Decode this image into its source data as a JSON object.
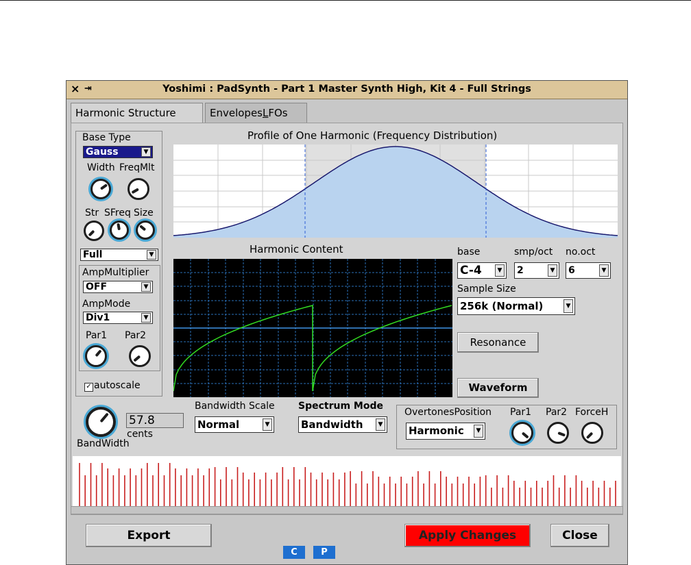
{
  "window": {
    "title": "Yoshimi : PadSynth - Part 1 Master Synth High, Kit 4 - Full Strings",
    "close_glyph": "×",
    "pin_glyph": "⇥"
  },
  "tabs": [
    {
      "label": "Harmonic Structure"
    },
    {
      "label": "EnvelopesLFOs"
    }
  ],
  "left": {
    "base_type_label": "Base Type",
    "base_type_value": "Gauss",
    "width_label": "Width",
    "freqmlt_label": "FreqMlt",
    "str_label": "Str",
    "sfreq_label": "SFreq",
    "size_label": "Size",
    "full_value": "Full",
    "ampmultiplier_label": "AmpMultiplier",
    "ampmultiplier_value": "OFF",
    "ampmode_label": "AmpMode",
    "ampmode_value": "Div1",
    "par1_label": "Par1",
    "par2_label": "Par2",
    "autoscale_label": "autoscale",
    "autoscale_checked": true
  },
  "profile": {
    "title": "Profile of One Harmonic (Frequency Distribution)"
  },
  "harmonic_content": {
    "title": "Harmonic Content"
  },
  "right": {
    "base_label": "base",
    "base_value": "C-4",
    "smp_oct_label": "smp/oct",
    "smp_oct_value": "2",
    "no_oct_label": "no.oct",
    "no_oct_value": "6",
    "sample_size_label": "Sample Size",
    "sample_size_value": "256k (Normal)",
    "resonance_label": "Resonance",
    "waveform_label": "Waveform"
  },
  "bandwidth": {
    "value": "57.8",
    "unit": "cents",
    "label": "BandWidth",
    "scale_label": "Bandwidth Scale",
    "scale_value": "Normal",
    "spectrum_mode_label": "Spectrum Mode",
    "spectrum_mode_value": "Bandwidth"
  },
  "overtones": {
    "position_label": "OvertonesPosition",
    "position_value": "Harmonic",
    "par1_label": "Par1",
    "par2_label": "Par2",
    "forceh_label": "ForceH"
  },
  "bottom": {
    "export_label": "Export",
    "apply_label": "Apply Changes",
    "close_label": "Close",
    "c_label": "C",
    "p_label": "P"
  },
  "colors": {
    "titlebar": "#dcc69a",
    "profile_fill": "#b9d3ef",
    "profile_line": "#1a1a6e",
    "spectrum_line": "#33dd22",
    "harmonics_line": "#c81e1e",
    "apply_bg": "#ff0000",
    "knob_highlight": "#4aa9d6"
  }
}
